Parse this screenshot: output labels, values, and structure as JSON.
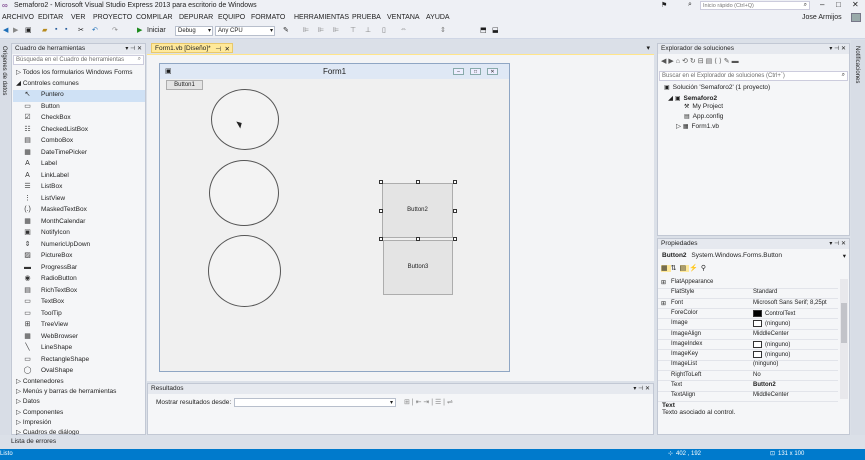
{
  "window": {
    "title": "Semaforo2 - Microsoft Visual Studio Express 2013 para escritorio de Windows",
    "quick_launch_placeholder": "Inicio rápido (Ctrl+Q)",
    "user": "Jose Armijos"
  },
  "menu": [
    "ARCHIVO",
    "EDITAR",
    "VER",
    "PROYECTO",
    "COMPILAR",
    "DEPURAR",
    "EQUIPO",
    "FORMATO",
    "HERRAMIENTAS",
    "PRUEBA",
    "VENTANA",
    "AYUDA"
  ],
  "toolbar": {
    "start_label": "Iniciar",
    "config_value": "Debug",
    "platform_value": "Any CPU"
  },
  "side_tabs": {
    "left": "Orígenes de datos",
    "right": "Notificaciones"
  },
  "toolbox": {
    "title": "Cuadro de herramientas",
    "search_placeholder": "Búsqueda en el Cuadro de herramientas",
    "groups_top": [
      "Todos los formularios Windows Forms",
      "Controles comunes"
    ],
    "items": [
      {
        "label": "Puntero",
        "icon": "pointer-icon",
        "glyph": "↖"
      },
      {
        "label": "Button",
        "icon": "button-icon",
        "glyph": "▭"
      },
      {
        "label": "CheckBox",
        "icon": "checkbox-icon",
        "glyph": "☑"
      },
      {
        "label": "CheckedListBox",
        "icon": "checkedlistbox-icon",
        "glyph": "☷"
      },
      {
        "label": "ComboBox",
        "icon": "combobox-icon",
        "glyph": "▤"
      },
      {
        "label": "DateTimePicker",
        "icon": "datetimepicker-icon",
        "glyph": "▦"
      },
      {
        "label": "Label",
        "icon": "label-icon",
        "glyph": "A"
      },
      {
        "label": "LinkLabel",
        "icon": "linklabel-icon",
        "glyph": "A"
      },
      {
        "label": "ListBox",
        "icon": "listbox-icon",
        "glyph": "☰"
      },
      {
        "label": "ListView",
        "icon": "listview-icon",
        "glyph": "⋮"
      },
      {
        "label": "MaskedTextBox",
        "icon": "maskedtextbox-icon",
        "glyph": "(.)"
      },
      {
        "label": "MonthCalendar",
        "icon": "monthcalendar-icon",
        "glyph": "▦"
      },
      {
        "label": "NotifyIcon",
        "icon": "notifyicon-icon",
        "glyph": "▣"
      },
      {
        "label": "NumericUpDown",
        "icon": "numericupdown-icon",
        "glyph": "⇕"
      },
      {
        "label": "PictureBox",
        "icon": "picturebox-icon",
        "glyph": "▨"
      },
      {
        "label": "ProgressBar",
        "icon": "progressbar-icon",
        "glyph": "▬"
      },
      {
        "label": "RadioButton",
        "icon": "radiobutton-icon",
        "glyph": "◉"
      },
      {
        "label": "RichTextBox",
        "icon": "richtextbox-icon",
        "glyph": "▤"
      },
      {
        "label": "TextBox",
        "icon": "textbox-icon",
        "glyph": "▭"
      },
      {
        "label": "ToolTip",
        "icon": "tooltip-icon",
        "glyph": "▭"
      },
      {
        "label": "TreeView",
        "icon": "treeview-icon",
        "glyph": "⊞"
      },
      {
        "label": "WebBrowser",
        "icon": "webbrowser-icon",
        "glyph": "▦"
      },
      {
        "label": "LineShape",
        "icon": "lineshape-icon",
        "glyph": "╲"
      },
      {
        "label": "RectangleShape",
        "icon": "rectangleshape-icon",
        "glyph": "▭"
      },
      {
        "label": "OvalShape",
        "icon": "ovalshape-icon",
        "glyph": "◯"
      }
    ],
    "groups_bottom": [
      "Contenedores",
      "Menús y barras de herramientas",
      "Datos",
      "Componentes",
      "Impresión",
      "Cuadros de diálogo"
    ]
  },
  "document": {
    "tab_label": "Form1.vb [Diseño]*"
  },
  "form": {
    "title": "Form1",
    "button1": "Button1",
    "button2": "Button2",
    "button3": "Button3"
  },
  "output": {
    "title": "Resultados",
    "show_from_label": "Mostrar resultados desde:"
  },
  "solution_explorer": {
    "title": "Explorador de soluciones",
    "search_placeholder": "Buscar en el Explorador de soluciones (Ctrl+`)",
    "items": [
      {
        "label": "Solución 'Semaforo2' (1 proyecto)",
        "bold": false,
        "icon": "solution-icon"
      },
      {
        "label": "Semaforo2",
        "bold": true,
        "icon": "project-icon"
      },
      {
        "label": "My Project",
        "bold": false,
        "icon": "wrench-icon"
      },
      {
        "label": "App.config",
        "bold": false,
        "icon": "config-file-icon"
      },
      {
        "label": "Form1.vb",
        "bold": false,
        "icon": "form-file-icon"
      }
    ]
  },
  "properties": {
    "title": "Propiedades",
    "object": "Button2",
    "object_type": "System.Windows.Forms.Button",
    "rows": [
      {
        "name": "FlatAppearance",
        "value": "",
        "expand": true
      },
      {
        "name": "FlatStyle",
        "value": "Standard",
        "expand": false
      },
      {
        "name": "Font",
        "value": "Microsoft Sans Serif; 8,25pt",
        "expand": true
      },
      {
        "name": "ForeColor",
        "value": "ControlText",
        "swatch": "#000000",
        "expand": false
      },
      {
        "name": "Image",
        "value": "(ninguno)",
        "swatch": "#ffffff",
        "expand": false
      },
      {
        "name": "ImageAlign",
        "value": "MiddleCenter",
        "expand": false
      },
      {
        "name": "ImageIndex",
        "value": "(ninguno)",
        "swatch": "#ffffff",
        "expand": false
      },
      {
        "name": "ImageKey",
        "value": "(ninguno)",
        "swatch": "#ffffff",
        "expand": false
      },
      {
        "name": "ImageList",
        "value": "(ninguno)",
        "expand": false
      },
      {
        "name": "RightToLeft",
        "value": "No",
        "expand": false
      },
      {
        "name": "Text",
        "value": "Button2",
        "expand": false,
        "bold": true
      },
      {
        "name": "TextAlign",
        "value": "MiddleCenter",
        "expand": false
      }
    ],
    "desc_title": "Text",
    "desc_text": "Texto asociado al control."
  },
  "bottom": {
    "error_list_tab": "Lista de errores",
    "status_left": "Listo",
    "status_pos": "402 , 192",
    "status_size": "131 x 100"
  },
  "colors": {
    "accent": "#007acc",
    "active_tab": "#ffe99a"
  }
}
